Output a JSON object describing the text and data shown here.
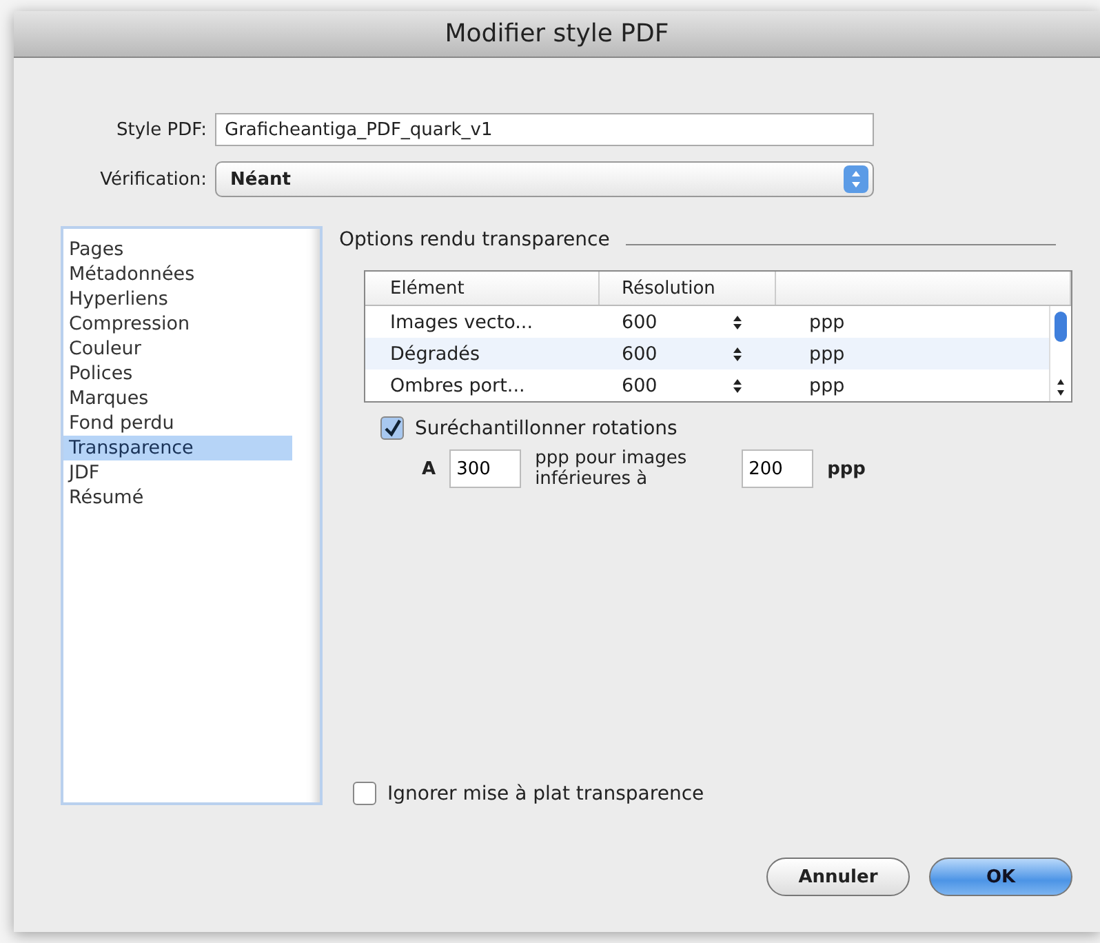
{
  "window": {
    "title": "Modifier style PDF"
  },
  "style_pdf": {
    "label": "Style PDF:",
    "value": "Graficheantiga_PDF_quark_v1"
  },
  "verification": {
    "label": "Vérification:",
    "value": "Néant"
  },
  "sidebar": {
    "items": [
      {
        "label": "Pages",
        "selected": false
      },
      {
        "label": "Métadonnées",
        "selected": false
      },
      {
        "label": "Hyperliens",
        "selected": false
      },
      {
        "label": "Compression",
        "selected": false
      },
      {
        "label": "Couleur",
        "selected": false
      },
      {
        "label": "Polices",
        "selected": false
      },
      {
        "label": "Marques",
        "selected": false
      },
      {
        "label": "Fond perdu",
        "selected": false
      },
      {
        "label": "Transparence",
        "selected": true
      },
      {
        "label": "JDF",
        "selected": false
      },
      {
        "label": "Résumé",
        "selected": false
      }
    ]
  },
  "section_title": "Options rendu transparence",
  "table": {
    "columns": [
      "Elément",
      "Résolution"
    ],
    "rows": [
      {
        "element": "Images vecto...",
        "resolution": "600",
        "unit": "ppp",
        "selected": false
      },
      {
        "element": "Dégradés",
        "resolution": "600",
        "unit": "ppp",
        "selected": true
      },
      {
        "element": "Ombres port...",
        "resolution": "600",
        "unit": "ppp",
        "selected": false
      }
    ]
  },
  "oversample": {
    "label": "Suréchantillonner rotations",
    "checked": true,
    "prefix": "A",
    "value_1": "300",
    "middle": "ppp pour images inférieures à",
    "value_2": "200",
    "suffix": "ppp"
  },
  "ignore_flatten": {
    "label": "Ignorer mise à plat transparence",
    "checked": false
  },
  "buttons": [
    {
      "label": "Annuler",
      "kind": "normal"
    },
    {
      "label": "OK",
      "kind": "default"
    }
  ]
}
